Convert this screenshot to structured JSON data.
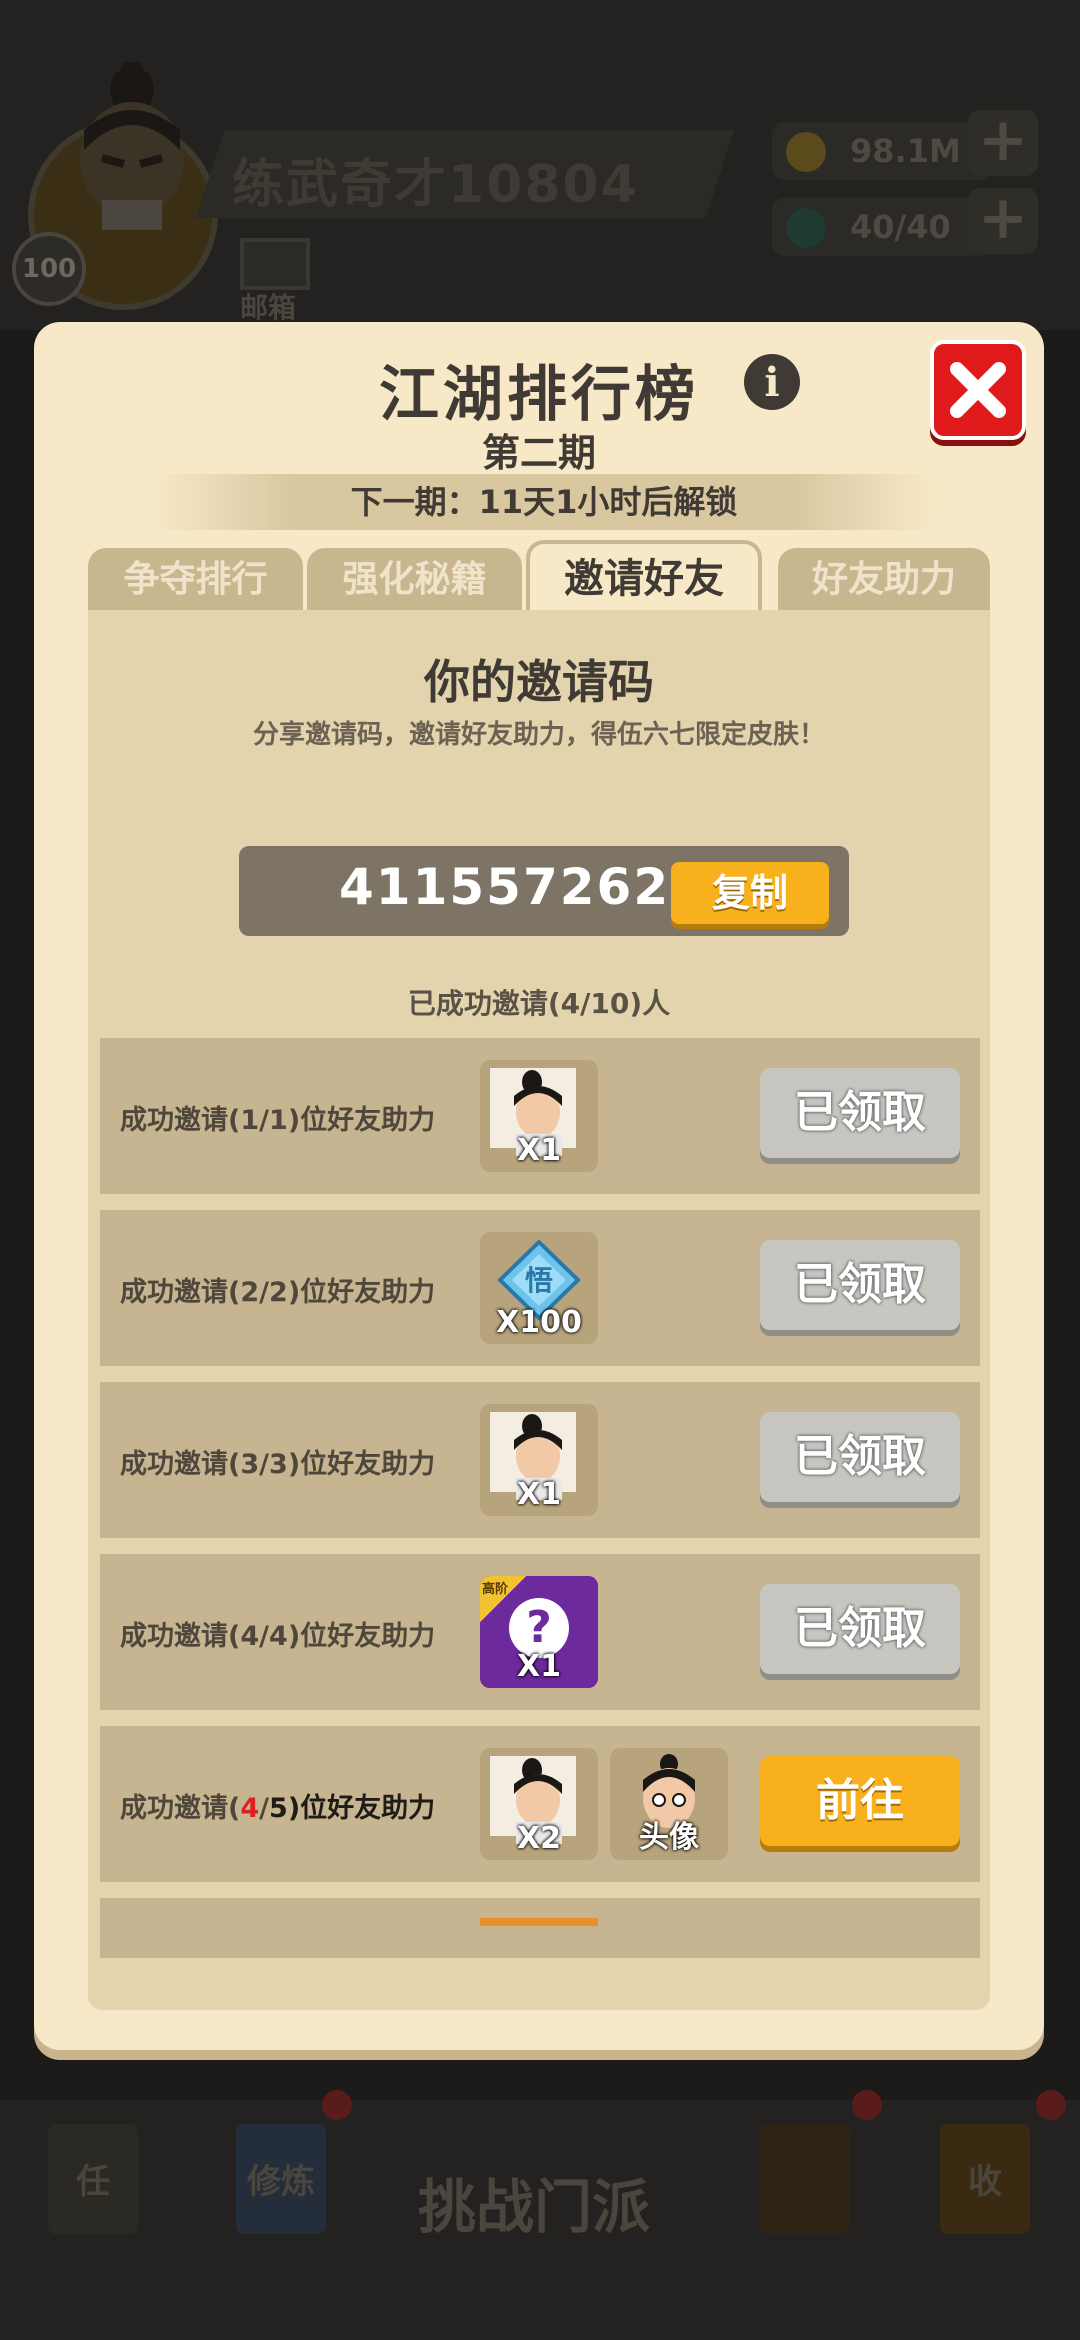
{
  "background": {
    "player_name": "练武奇才10804",
    "player_level": "100",
    "mail_label": "邮箱",
    "resources": [
      {
        "value": "98.1M",
        "icon": "coin-icon",
        "color": "#8a6a1a"
      },
      {
        "value": "40/40",
        "icon": "energy-gem-icon",
        "color": "#1f4a3a"
      }
    ],
    "bottom_nav": {
      "task_label": "任",
      "cultivate_label": "修炼",
      "challenge_label": "挑战门派",
      "collect_label": "收"
    }
  },
  "modal": {
    "title": "江湖排行榜",
    "period": "第二期",
    "unlock_text": "下一期：11天1小时后解锁",
    "tabs": [
      {
        "label": "争夺排行",
        "active": false
      },
      {
        "label": "强化秘籍",
        "active": false
      },
      {
        "label": "邀请好友",
        "active": true
      },
      {
        "label": "好友助力",
        "active": false
      }
    ],
    "invite": {
      "title": "你的邀请码",
      "description": "分享邀请码，邀请好友助力，得伍六七限定皮肤！",
      "code": "411557262",
      "copy_label": "复制",
      "count_text": "已成功邀请(4/10)人"
    },
    "rewards": [
      {
        "prefix": "成功邀请(",
        "current": "1",
        "sep": "/",
        "target": "1",
        "suffix": ")位好友助力",
        "items": [
          {
            "icon": "character-portrait-icon",
            "qty": "X1"
          }
        ],
        "button": "已领取",
        "claimed": true
      },
      {
        "prefix": "成功邀请(",
        "current": "2",
        "sep": "/",
        "target": "2",
        "suffix": ")位好友助力",
        "items": [
          {
            "icon": "enlightenment-gem-icon",
            "qty": "X100"
          }
        ],
        "button": "已领取",
        "claimed": true
      },
      {
        "prefix": "成功邀请(",
        "current": "3",
        "sep": "/",
        "target": "3",
        "suffix": ")位好友助力",
        "items": [
          {
            "icon": "character-portrait-icon",
            "qty": "X1"
          }
        ],
        "button": "已领取",
        "claimed": true
      },
      {
        "prefix": "成功邀请(",
        "current": "4",
        "sep": "/",
        "target": "4",
        "suffix": ")位好友助力",
        "items": [
          {
            "icon": "mystery-box-icon",
            "qty": "X1",
            "tag": "高阶"
          }
        ],
        "button": "已领取",
        "claimed": true
      },
      {
        "prefix": "成功邀请(",
        "current": "4",
        "sep": "/",
        "target": "5",
        "suffix": ")位好友助力",
        "items": [
          {
            "icon": "character-portrait-icon",
            "qty": "X2"
          },
          {
            "icon": "avatar-head-icon",
            "qty": "头像"
          }
        ],
        "button": "前往",
        "claimed": false
      }
    ]
  },
  "colors": {
    "modal_bg": "#f7e8c7",
    "accent_orange": "#f8b11d",
    "close_red": "#e01a1a",
    "claimed_gray": "#c7c6c1",
    "highlight_red": "#e02020"
  }
}
